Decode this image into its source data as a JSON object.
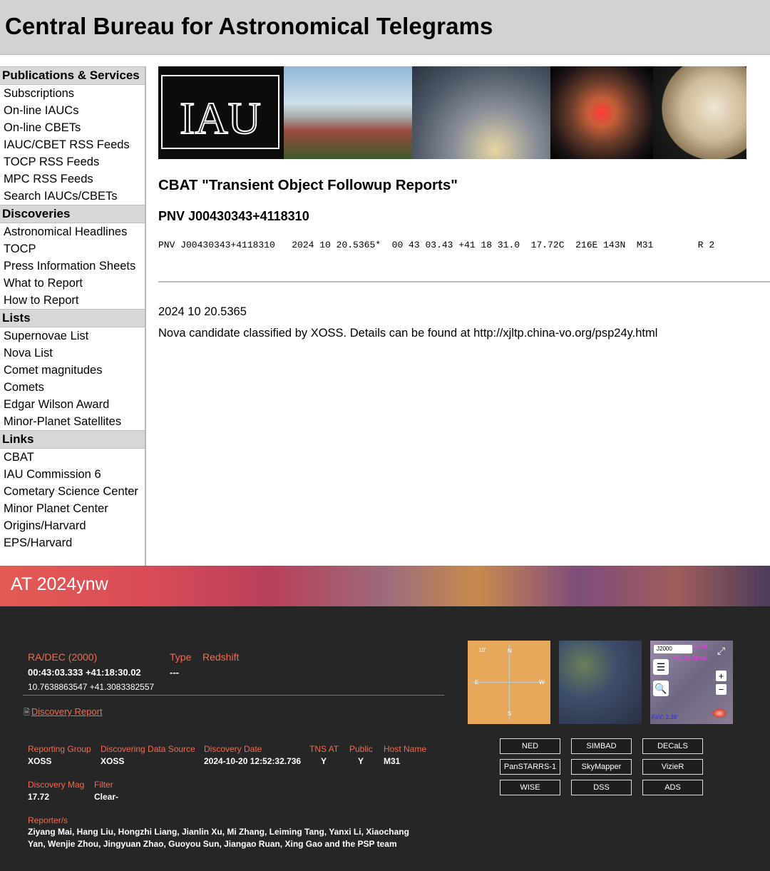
{
  "site_title": "Central Bureau for Astronomical Telegrams",
  "sidebar": {
    "sections": [
      {
        "heading": "Publications & Services",
        "items": [
          "Subscriptions",
          "On-line IAUCs",
          "On-line CBETs",
          "IAUC/CBET RSS Feeds",
          "TOCP RSS Feeds",
          "MPC RSS Feeds",
          "Search IAUCs/CBETs"
        ]
      },
      {
        "heading": "Discoveries",
        "items": [
          "Astronomical Headlines",
          "TOCP",
          "Press Information Sheets",
          "What to Report",
          "How to Report"
        ]
      },
      {
        "heading": "Lists",
        "items": [
          "Supernovae List",
          "Nova List",
          "Comet magnitudes",
          "Comets",
          "Edgar Wilson Award",
          "Minor-Planet Satellites"
        ]
      },
      {
        "heading": "Links",
        "items": [
          "CBAT",
          "IAU Commission 6",
          "Cometary Science Center",
          "Minor Planet Center",
          "Origins/Harvard",
          "EPS/Harvard"
        ]
      }
    ]
  },
  "banner": {
    "logo_text": "IAU"
  },
  "report": {
    "title": "CBAT \"Transient Object Followup Reports\"",
    "object_id": "PNV J00430343+4118310",
    "data_line": "PNV J00430343+4118310   2024 10 20.5365*  00 43 03.43 +41 18 31.0  17.72C  216E 143N  M31        R 2",
    "date": "2024 10 20.5365",
    "note": "Nova candidate classified by XOSS. Details can be found at http://xjltp.china-vo.org/psp24y.html"
  },
  "tns": {
    "name": "AT 2024ynw",
    "radec_label": "RA/DEC (2000)",
    "radec_sexagesimal": "00:43:03.333 +41:18:30.02",
    "radec_degrees": "10.7638863547 +41.3083382557",
    "type_label": "Type",
    "type_value": "---",
    "redshift_label": "Redshift",
    "discovery_report_link": "Discovery Report",
    "fields": {
      "reporting_group_label": "Reporting Group",
      "reporting_group": "XOSS",
      "data_source_label": "Discovering Data Source",
      "data_source": "XOSS",
      "discovery_date_label": "Discovery Date",
      "discovery_date": "2024-10-20 12:52:32.736",
      "tns_at_label": "TNS AT",
      "tns_at": "Y",
      "public_label": "Public",
      "public": "Y",
      "host_label": "Host Name",
      "host": "M31",
      "mag_label": "Discovery Mag",
      "mag": "17.72",
      "filter_label": "Filter",
      "filter": "Clear-"
    },
    "reporters_label": "Reporter/s",
    "reporters": "Ziyang Mai, Hang Liu, Hongzhi Liang, Jianlin Xu, Mi Zhang, Leiming Tang, Yanxi Li, Xiaochang Yan, Wenjie Zhou, Jingyuan Zhao, Guoyou Sun, Jiangao Ruan, Xing Gao and the PSP team",
    "thumb1": {
      "scale": "10'",
      "n": "N",
      "e": "E",
      "w": "W",
      "s": "S"
    },
    "aladin": {
      "frame": "J2000",
      "ra": "00 43",
      "dec": "+41 18 30.02",
      "fov": "FoV: 2.38'",
      "plus": "+",
      "minus": "−"
    },
    "buttons": [
      "NED",
      "SIMBAD",
      "DECaLS",
      "PanSTARRS-1",
      "SkyMapper",
      "VizieR",
      "WISE",
      "DSS",
      "ADS"
    ]
  }
}
